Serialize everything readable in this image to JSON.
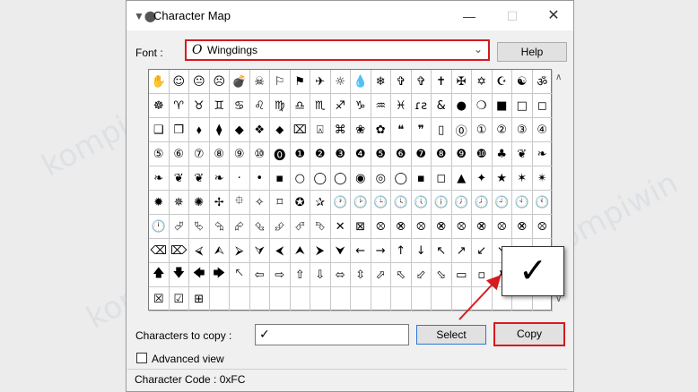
{
  "window": {
    "title": "Character Map",
    "minimize": "—",
    "maximize": "☐",
    "close": "✕"
  },
  "font": {
    "label": "Font :",
    "value": "Wingdings",
    "icon": "O"
  },
  "buttons": {
    "help": "Help",
    "select": "Select",
    "copy": "Copy"
  },
  "copy_field": {
    "label": "Characters to copy :",
    "value": "✓"
  },
  "advanced_view": {
    "label": "Advanced view",
    "checked": false
  },
  "status": {
    "text": "Character Code : 0xFC"
  },
  "selected_char": "✓",
  "watermark": "kompiwin",
  "accent_color": "#d71920",
  "grid_rows": [
    [
      "✋",
      "☺",
      "😐",
      "☹",
      "💣",
      "☠",
      "⚐",
      "⚑",
      "✈",
      "☼",
      "💧",
      "❄",
      "✞",
      "✞",
      "✝",
      "✠",
      "✡",
      "☪",
      "☯",
      "ॐ"
    ],
    [
      "☸",
      "♈",
      "♉",
      "♊",
      "♋",
      "♌",
      "♍",
      "♎",
      "♏",
      "♐",
      "♑",
      "♒",
      "♓",
      "ɾƨ",
      "&",
      "●",
      "❍",
      "■",
      "□",
      "◻"
    ],
    [
      "❑",
      "❒",
      "⬧",
      "⧫",
      "◆",
      "❖",
      "⬥",
      "⌧",
      "⍓",
      "⌘",
      "❀",
      "✿",
      "❝",
      "❞",
      "▯",
      "⓪",
      "①",
      "②",
      "③",
      "④"
    ],
    [
      "⑤",
      "⑥",
      "⑦",
      "⑧",
      "⑨",
      "⑩",
      "⓿",
      "❶",
      "❷",
      "❸",
      "❹",
      "❺",
      "❻",
      "❼",
      "❽",
      "❾",
      "❿",
      "♣",
      "❦",
      "❧"
    ],
    [
      "❧",
      "❦",
      "❦",
      "❧",
      "·",
      "•",
      "▪",
      "○",
      "◯",
      "◯",
      "◉",
      "◎",
      "◯",
      "▪",
      "◻",
      "▲",
      "✦",
      "★",
      "✶",
      "✴"
    ],
    [
      "✹",
      "✵",
      "✺",
      "✢",
      "⯐",
      "✧",
      "⌑",
      "✪",
      "✰",
      "🕐",
      "🕑",
      "🕒",
      "🕓",
      "🕔",
      "🕕",
      "🕖",
      "🕗",
      "🕘",
      "🕙",
      "🕚"
    ],
    [
      "🕛",
      "⮰",
      "⮱",
      "⮲",
      "⮳",
      "⮴",
      "⮵",
      "⮶",
      "⮷",
      "✕",
      "⊠",
      "⮾",
      "⮿",
      "⮾",
      "⮿",
      "⮾",
      "⮿",
      "⮾",
      "⮿",
      "⮾"
    ],
    [
      "⌫",
      "⌦",
      "⮘",
      "⮙",
      "⮚",
      "⮛",
      "⮜",
      "⮝",
      "⮞",
      "⮟",
      "←",
      "→",
      "↑",
      "↓",
      "↖",
      "↗",
      "↙",
      "↘",
      "➔",
      "⬌"
    ],
    [
      "🡅",
      "🡇",
      "🡄",
      "🡆",
      "🡔",
      "⇦",
      "⇨",
      "⇧",
      "⇩",
      "⬄",
      "⇳",
      "⬀",
      "⬁",
      "⬃",
      "⬂",
      "▭",
      "▫",
      "✗",
      "✓",
      "☒"
    ],
    [
      "☒",
      "☑",
      "⊞",
      "",
      "",
      "",
      "",
      "",
      "",
      "",
      "",
      "",
      "",
      "",
      "",
      "",
      "",
      "",
      "",
      ""
    ]
  ]
}
